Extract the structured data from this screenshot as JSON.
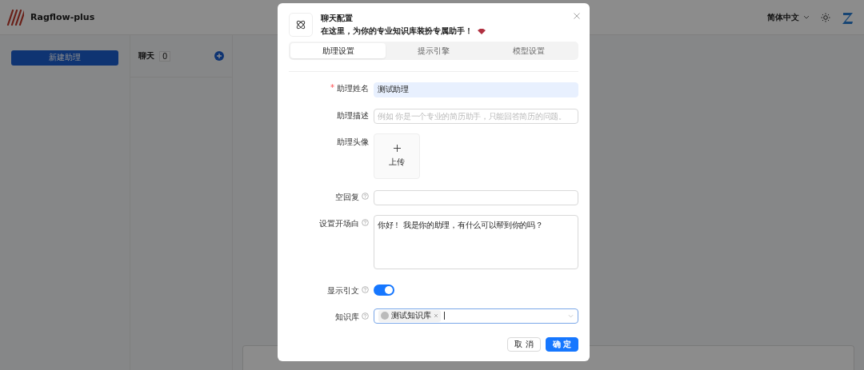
{
  "app": {
    "name": "Ragflow-plus"
  },
  "header": {
    "language": "简体中文"
  },
  "sidebar": {
    "new_button": "新建助理"
  },
  "chat_list": {
    "title": "聊天",
    "count": "0"
  },
  "dialog": {
    "title": "聊天配置",
    "subtitle": "在这里，为你的专业知识库装扮专属助手！",
    "tabs": [
      {
        "label": "助理设置",
        "selected": true
      },
      {
        "label": "提示引擎",
        "selected": false
      },
      {
        "label": "模型设置",
        "selected": false
      }
    ],
    "fields": [
      {
        "kind": "text",
        "label": "助理姓名",
        "required_mark": "*",
        "help": false,
        "value": "测试助理"
      },
      {
        "kind": "text",
        "label": "助理描述",
        "help": false,
        "placeholder": "例如 你是一个专业的简历助手，只能回答简历的问题。"
      },
      {
        "kind": "upload",
        "label": "助理头像",
        "help": false,
        "upload_label": "上传"
      },
      {
        "kind": "text",
        "label": "空回复",
        "help": true
      },
      {
        "kind": "textarea",
        "label": "设置开场白",
        "help": true,
        "value": "你好！ 我是你的助理，有什么可以帮到你的吗？"
      },
      {
        "kind": "switch",
        "label": "显示引文",
        "help": true,
        "on": true
      },
      {
        "kind": "tags",
        "label": "知识库",
        "help": true,
        "tags": [
          "测试知识库"
        ]
      }
    ],
    "buttons": [
      {
        "label": "取 消",
        "primary": false
      },
      {
        "label": "确 定",
        "primary": true
      }
    ]
  }
}
